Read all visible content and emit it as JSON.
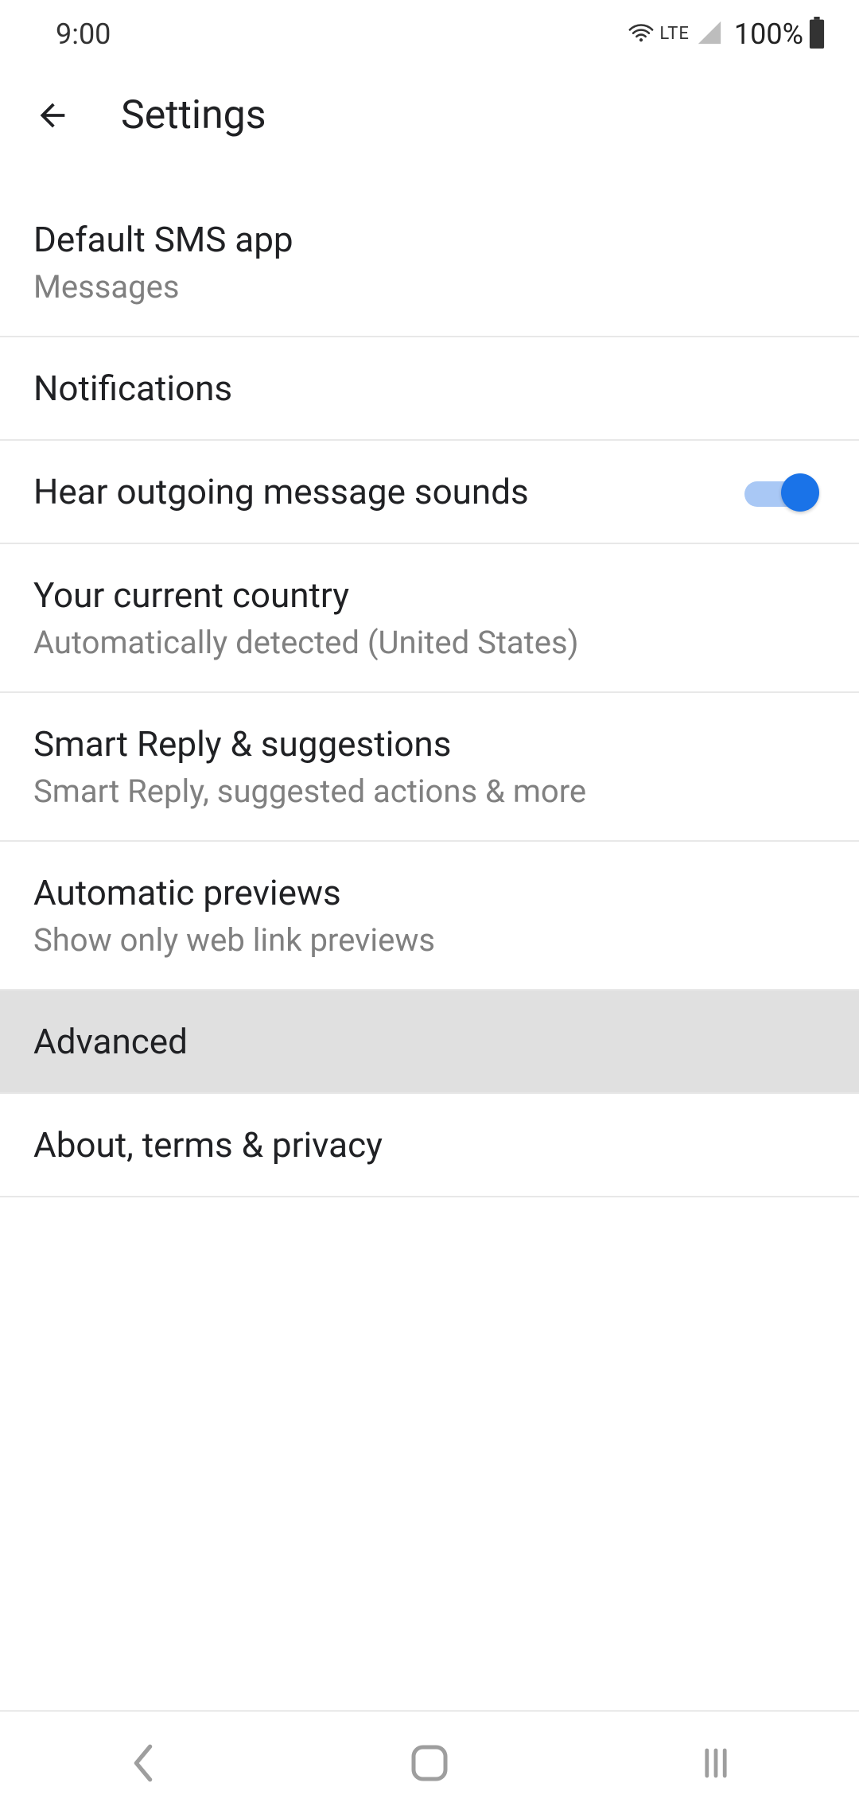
{
  "status": {
    "time": "9:00",
    "lte": "LTE",
    "battery_percent": "100%"
  },
  "appbar": {
    "title": "Settings"
  },
  "settings": [
    {
      "key": "default_sms",
      "title": "Default SMS app",
      "subtitle": "Messages",
      "has_toggle": false,
      "highlighted": false
    },
    {
      "key": "notifications",
      "title": "Notifications",
      "subtitle": null,
      "has_toggle": false,
      "highlighted": false
    },
    {
      "key": "outgoing_sounds",
      "title": "Hear outgoing message sounds",
      "subtitle": null,
      "has_toggle": true,
      "toggle_on": true,
      "highlighted": false
    },
    {
      "key": "current_country",
      "title": "Your current country",
      "subtitle": "Automatically detected (United States)",
      "has_toggle": false,
      "highlighted": false
    },
    {
      "key": "smart_reply",
      "title": "Smart Reply & suggestions",
      "subtitle": "Smart Reply, suggested actions & more",
      "has_toggle": false,
      "highlighted": false
    },
    {
      "key": "auto_previews",
      "title": "Automatic previews",
      "subtitle": "Show only web link previews",
      "has_toggle": false,
      "highlighted": false
    },
    {
      "key": "advanced",
      "title": "Advanced",
      "subtitle": null,
      "has_toggle": false,
      "highlighted": true
    },
    {
      "key": "about",
      "title": "About, terms & privacy",
      "subtitle": null,
      "has_toggle": false,
      "highlighted": false
    }
  ]
}
